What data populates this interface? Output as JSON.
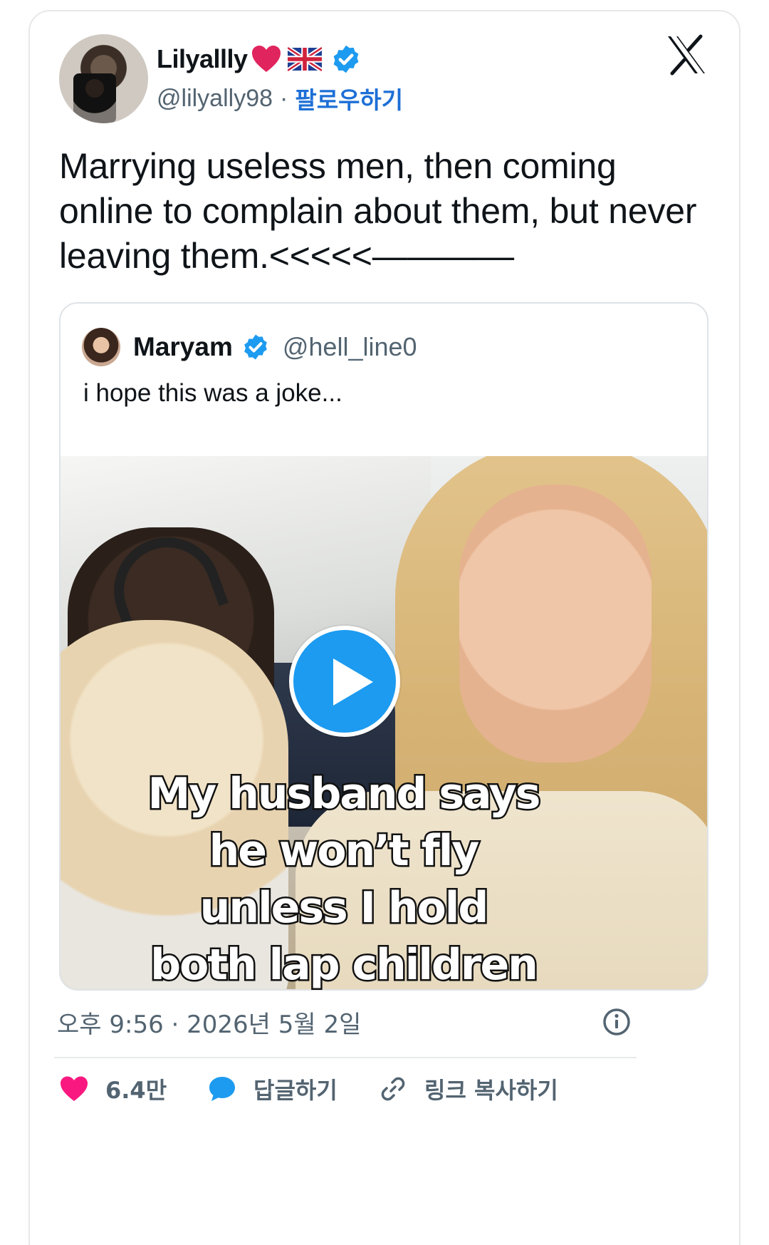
{
  "tweet": {
    "display_name": "Lilyallly",
    "handle": "@lilyally98",
    "separator": "·",
    "follow_label": "팔로우하기",
    "text": "Marrying useless men, then coming online to complain about them, but never leaving them.<<<<<————",
    "timestamp": "오후 9:56 · 2026년 5월 2일",
    "icons": [
      "heart-emoji",
      "uk-flag-emoji",
      "verified-badge",
      "x-logo",
      "info-icon"
    ]
  },
  "quote": {
    "display_name": "Maryam",
    "handle": "@hell_line0",
    "text": "i hope this was a joke...",
    "video_caption": [
      "My husband says",
      "he won’t fly",
      "unless I hold",
      "both lap children"
    ]
  },
  "actions": {
    "like_count": "6.4만",
    "reply_label": "답글하기",
    "copy_link_label": "링크 복사하기"
  },
  "colors": {
    "accent": "#1d9bf0",
    "like": "#f91880",
    "muted": "#536471",
    "text": "#0f1419"
  }
}
